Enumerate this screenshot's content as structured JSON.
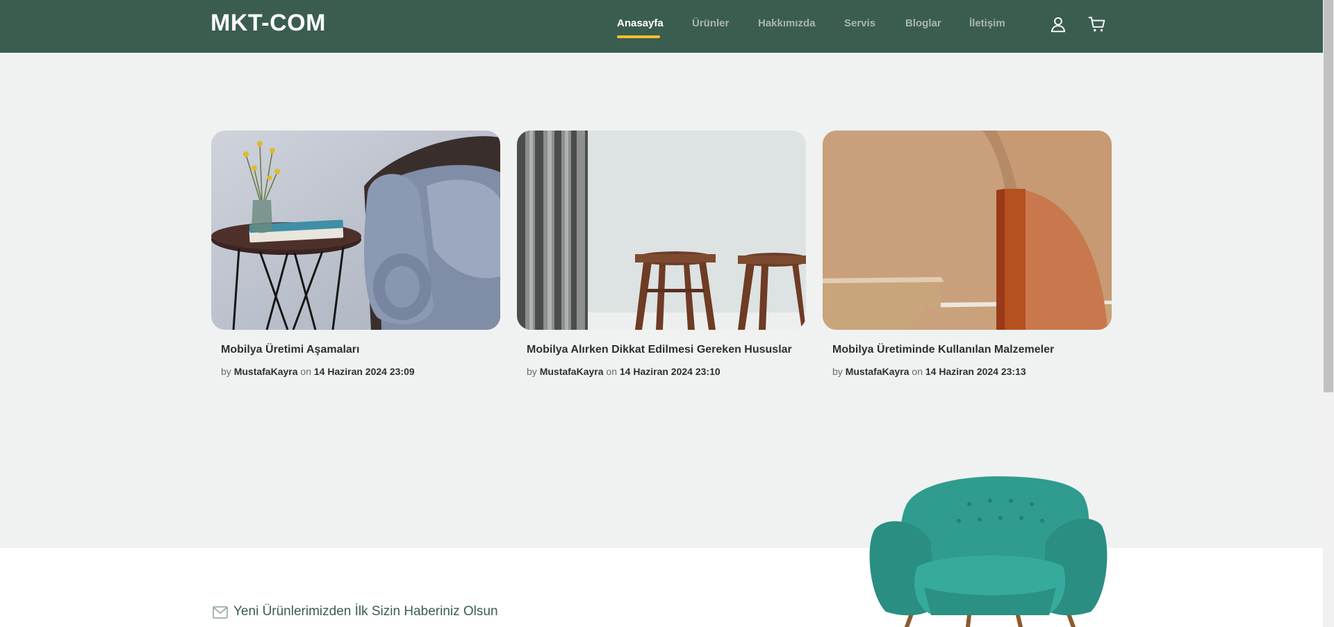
{
  "header": {
    "logo": "MKT-COM",
    "nav": [
      {
        "label": "Anasayfa",
        "active": true
      },
      {
        "label": "Ürünler",
        "active": false
      },
      {
        "label": "Hakkımızda",
        "active": false
      },
      {
        "label": "Servis",
        "active": false
      },
      {
        "label": "Bloglar",
        "active": false
      },
      {
        "label": "İletişim",
        "active": false
      }
    ],
    "icons": [
      "user-icon",
      "cart-icon"
    ]
  },
  "posts": [
    {
      "title": "Mobilya Üretimi Aşamaları",
      "by": "by",
      "author": "MustafaKayra",
      "on": "on",
      "date": "14 Haziran 2024 23:09",
      "image": "side-table-sofa-image"
    },
    {
      "title": "Mobilya Alırken Dikkat Edilmesi Gereken Hususlar",
      "by": "by",
      "author": "MustafaKayra",
      "on": "on",
      "date": "14 Haziran 2024 23:10",
      "image": "wooden-stools-image"
    },
    {
      "title": "Mobilya Üretiminde Kullanılan Malzemeler",
      "by": "by",
      "author": "MustafaKayra",
      "on": "on",
      "date": "14 Haziran 2024 23:13",
      "image": "wood-shapes-image"
    }
  ],
  "newsletter": {
    "label": "Yeni Ürünlerimizden İlk Sizin Haberiniz Olsun",
    "icon": "envelope-icon"
  },
  "colors": {
    "header_bg": "#3b5d50",
    "accent": "#f9bf29",
    "page_bg": "#eff2f1",
    "chair": "#2f9c8f"
  }
}
